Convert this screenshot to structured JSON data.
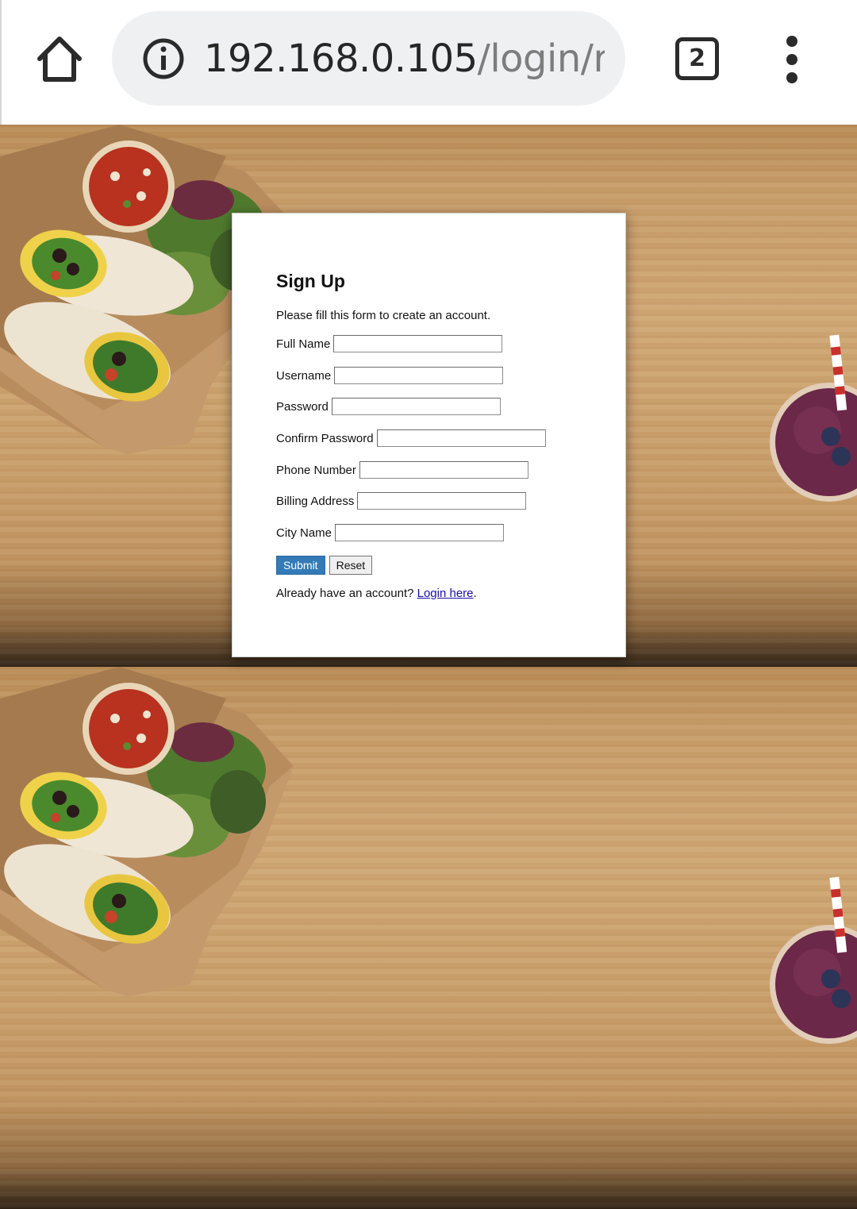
{
  "browser": {
    "url_host": "192.168.0.105",
    "url_path": "/login/re",
    "tab_count": "2",
    "icons": {
      "home": "home-icon",
      "info": "info-icon",
      "tabs": "tab-switcher-icon",
      "menu": "overflow-menu-icon"
    }
  },
  "form": {
    "title": "Sign Up",
    "lead": "Please fill this form to create an account.",
    "fields": [
      {
        "label": "Full Name",
        "value": ""
      },
      {
        "label": "Username",
        "value": ""
      },
      {
        "label": "Password",
        "value": ""
      },
      {
        "label": "Confirm Password",
        "value": ""
      },
      {
        "label": "Phone Number",
        "value": ""
      },
      {
        "label": "Billing Address",
        "value": ""
      },
      {
        "label": "City Name",
        "value": ""
      }
    ],
    "submit_label": "Submit",
    "reset_label": "Reset",
    "login_prompt": "Already have an account?",
    "login_link": "Login here",
    "login_suffix": "."
  },
  "colors": {
    "submit_bg": "#337ab7",
    "link": "#1a0dab",
    "wood": "#cfa774"
  }
}
